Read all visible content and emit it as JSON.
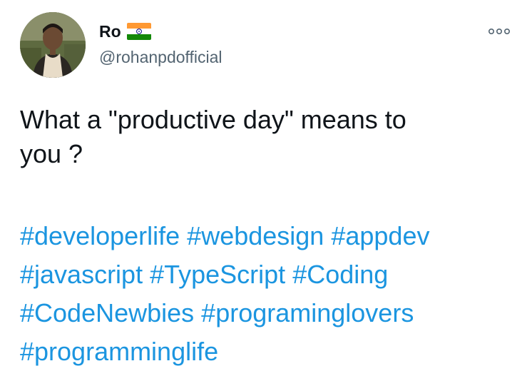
{
  "author": {
    "display_name": "Ro",
    "handle": "@rohanpdofficial",
    "flag_icon": "india-flag-icon",
    "avatar_icon": "profile-photo"
  },
  "menu": {
    "icon": "more-options-icon"
  },
  "tweet": {
    "text": "What a \"productive day\" means to\nyou ?",
    "hashtags": [
      "#developerlife",
      "#webdesign",
      "#appdev",
      "#javascript",
      "#TypeScript",
      "#Coding",
      "#CodeNewbies",
      "#programinglovers",
      "#programminglife"
    ]
  },
  "colors": {
    "text": "#0f1419",
    "secondary": "#536471",
    "link": "#1b95e0",
    "saffron": "#ff9933",
    "green": "#138808",
    "chakra": "#000080"
  }
}
